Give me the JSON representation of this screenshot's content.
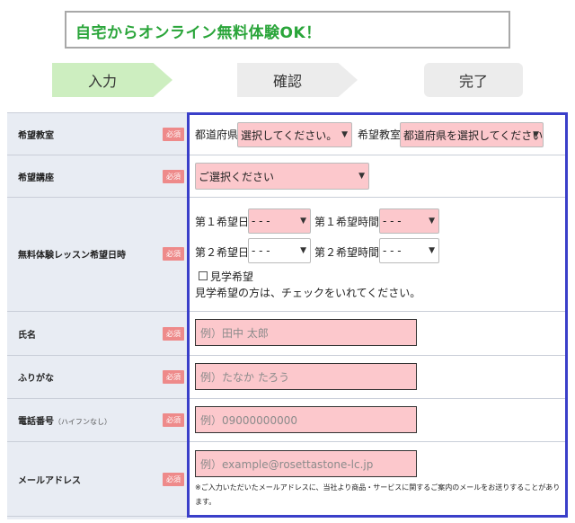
{
  "banner": {
    "text": "自宅からオンライン無料体験OK！"
  },
  "steps": [
    {
      "label": "入力",
      "active": true
    },
    {
      "label": "確認",
      "active": false
    },
    {
      "label": "完了",
      "active": false
    }
  ],
  "required_badge": "必須",
  "rows": {
    "classroom": {
      "label": "希望教室",
      "pref_label": "都道府県",
      "pref_value": "選択してください。",
      "class_label": "希望教室",
      "class_value": "都道府県を選択してください"
    },
    "course": {
      "label": "希望講座",
      "value": "ご選択ください"
    },
    "lesson": {
      "label": "無料体験レッスン希望日時",
      "date1_label": "第１希望日",
      "date1_value": "- - -",
      "time1_label": "第１希望時間",
      "time1_value": "- - -",
      "date2_label": "第２希望日",
      "date2_value": "- - -",
      "time2_label": "第２希望時間",
      "time2_value": "- - -",
      "visit_label": "見学希望",
      "visit_checked": false,
      "visit_note": "見学希望の方は、チェックをいれてください。"
    },
    "name": {
      "label": "氏名",
      "placeholder": "例）田中 太郎"
    },
    "kana": {
      "label": "ふりがな",
      "placeholder": "例）たなか たろう"
    },
    "phone": {
      "label": "電話番号",
      "label_sub": "（ハイフンなし）",
      "placeholder": "例）09000000000"
    },
    "email": {
      "label": "メールアドレス",
      "placeholder": "例）example@rosettastone-lc.jp",
      "note": "※ご入力いただいたメールアドレスに、当社より商品・サービスに関するご案内のメールをお送りすることがあります。"
    }
  },
  "colors": {
    "accent_green": "#2aa53a",
    "border_blue": "#3a3fc9",
    "required_pink": "#ee8a8a",
    "field_pink": "#fcc8cc"
  }
}
